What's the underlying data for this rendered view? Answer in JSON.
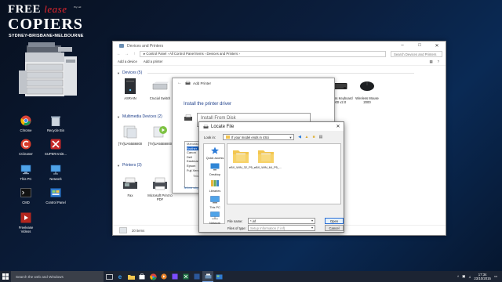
{
  "brand": {
    "line1_a": "FREE",
    "line1_b": "lease",
    "ptyltd": "Pty Ltd",
    "line2": "COPIERS",
    "line3": "SYDNEY•BRISBANE•MELBOURNE"
  },
  "desktop_icons": [
    {
      "label": "Chrome"
    },
    {
      "label": "Recycle Bin"
    },
    {
      "label": "CCleaner"
    },
    {
      "label": "SUPERAntiS..."
    },
    {
      "label": "This PC"
    },
    {
      "label": "Network"
    },
    {
      "label": "CMD"
    },
    {
      "label": "Control Panel"
    },
    {
      "label": "Freelease Videos"
    }
  ],
  "window": {
    "title": "Devices and Printers",
    "breadcrumb": "▸ Control Panel  ›  All Control Panel Items  ›  Devices and Printers  ›",
    "search_placeholder": "Search Devices and Printers",
    "cmd_add_device": "Add a device",
    "cmd_add_printer": "Add a printer",
    "sections": {
      "devices": "Devices (5)",
      "multimedia": "Multimedia Devices (2)",
      "printers": "Printers (3)"
    },
    "devices": [
      {
        "label": "ASRAIN"
      },
      {
        "label": "Crucial Switch"
      },
      {
        "label": "Wireless Keyboard 2000 v2.0"
      },
      {
        "label": "Wireless Mouse 2000"
      }
    ],
    "multimedia": [
      {
        "label": "[TV]UA55B6800"
      },
      {
        "label": "[TV]UA55B6800"
      }
    ],
    "printers": [
      {
        "label": "Fax"
      },
      {
        "label": "Microsoft Print to PDF"
      }
    ],
    "status": "20 items"
  },
  "wizard": {
    "title": "Add Printer",
    "heading": "Install the printer driver",
    "manufacturer_header": "Manufacturer",
    "manufacturers": [
      "Brother",
      "Canon",
      "Dell",
      "Eastman",
      "Epson",
      "Fuji Xerox"
    ],
    "selected_index": 0,
    "signed_note": "This driver is digitally signed.",
    "tell_me": "Tell me why driver signing is important"
  },
  "install_from_disk": {
    "title": "Install From Disk"
  },
  "locate_file": {
    "title": "Locate File",
    "look_in_label": "Look in:",
    "look_in_value": "If your model ends in 4Sci",
    "places": [
      {
        "label": "Quick access"
      },
      {
        "label": "Desktop"
      },
      {
        "label": "Libraries"
      },
      {
        "label": "This PC"
      },
      {
        "label": "Network"
      }
    ],
    "files": [
      {
        "label": "eBX_WIN_32_P5_..."
      },
      {
        "label": "eBX_WIN_64_P5_..."
      }
    ],
    "file_name_label": "File name:",
    "file_name_value": "*.inf",
    "files_of_type_label": "Files of type:",
    "files_of_type_value": "Setup Information (*.inf)",
    "open_label": "Open",
    "cancel_label": "Cancel"
  },
  "taskbar": {
    "search_placeholder": "Search the web and Windows",
    "time": "17:34",
    "date": "23/10/2015"
  }
}
